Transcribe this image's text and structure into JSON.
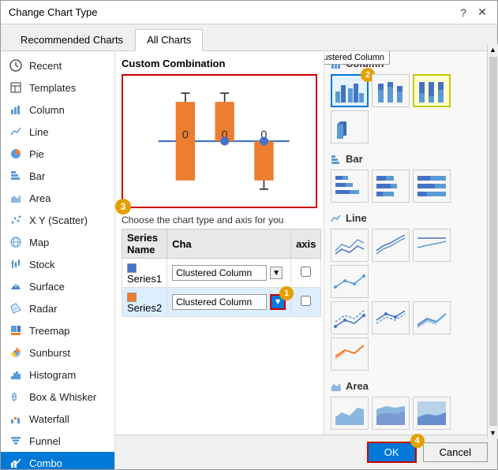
{
  "dialog": {
    "title": "Change Chart Type",
    "help_icon": "?",
    "close_icon": "✕"
  },
  "tabs": [
    {
      "id": "recommended",
      "label": "Recommended Charts",
      "active": false
    },
    {
      "id": "all",
      "label": "All Charts",
      "active": true
    }
  ],
  "sidebar": {
    "items": [
      {
        "id": "recent",
        "label": "Recent",
        "icon": "clock"
      },
      {
        "id": "templates",
        "label": "Templates",
        "icon": "template"
      },
      {
        "id": "column",
        "label": "Column",
        "icon": "column-chart"
      },
      {
        "id": "line",
        "label": "Line",
        "icon": "line-chart"
      },
      {
        "id": "pie",
        "label": "Pie",
        "icon": "pie-chart"
      },
      {
        "id": "bar",
        "label": "Bar",
        "icon": "bar-chart"
      },
      {
        "id": "area",
        "label": "Area",
        "icon": "area-chart"
      },
      {
        "id": "xy",
        "label": "X Y (Scatter)",
        "icon": "scatter-chart"
      },
      {
        "id": "map",
        "label": "Map",
        "icon": "map-chart"
      },
      {
        "id": "stock",
        "label": "Stock",
        "icon": "stock-chart"
      },
      {
        "id": "surface",
        "label": "Surface",
        "icon": "surface-chart"
      },
      {
        "id": "radar",
        "label": "Radar",
        "icon": "radar-chart"
      },
      {
        "id": "treemap",
        "label": "Treemap",
        "icon": "treemap-chart"
      },
      {
        "id": "sunburst",
        "label": "Sunburst",
        "icon": "sunburst-chart"
      },
      {
        "id": "histogram",
        "label": "Histogram",
        "icon": "histogram-chart"
      },
      {
        "id": "box",
        "label": "Box & Whisker",
        "icon": "box-chart"
      },
      {
        "id": "waterfall",
        "label": "Waterfall",
        "icon": "waterfall-chart"
      },
      {
        "id": "funnel",
        "label": "Funnel",
        "icon": "funnel-chart"
      },
      {
        "id": "combo",
        "label": "Combo",
        "icon": "combo-chart",
        "active": true
      }
    ]
  },
  "gallery": {
    "column_section": {
      "title": "Column",
      "icon": "column-icon",
      "types": [
        "clustered-column",
        "stacked-column",
        "100-stacked-column",
        "3d-clustered-column",
        "3d-stacked-column",
        "3d-100-stacked-column",
        "3d-column"
      ]
    },
    "bar_section": {
      "title": "Bar",
      "types": [
        "clustered-bar",
        "stacked-bar",
        "100-stacked-bar"
      ]
    },
    "line_section": {
      "title": "Line",
      "types": [
        "line",
        "stacked-line",
        "100-stacked-line",
        "line-markers",
        "stacked-line-markers",
        "100-stacked-line-markers",
        "3d-line"
      ]
    },
    "area_section": {
      "title": "Area",
      "types": [
        "area",
        "stacked-area",
        "100-stacked-area"
      ]
    },
    "tooltip": "Clustered Column"
  },
  "combo": {
    "title": "Custom Combination",
    "choose_text": "Choose the chart type and axis for you",
    "table": {
      "headers": [
        "Series Name",
        "Cha",
        "axis"
      ],
      "rows": [
        {
          "name": "Series1",
          "color": "#4472c4",
          "chart_type": "Clustered Column",
          "axis": false
        },
        {
          "name": "Series2",
          "color": "#ed7d31",
          "chart_type": "Clustered Column",
          "axis": false,
          "selected": true
        }
      ]
    }
  },
  "badges": {
    "badge1": "1",
    "badge2": "2",
    "badge3": "3",
    "badge4": "4"
  },
  "footer": {
    "ok_label": "OK",
    "cancel_label": "Cancel"
  }
}
